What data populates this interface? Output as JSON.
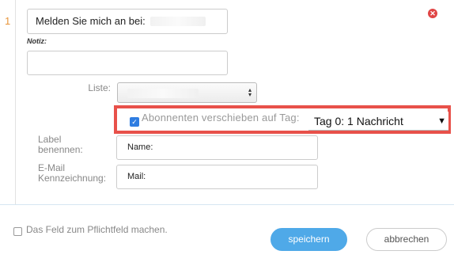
{
  "step": {
    "number": "1"
  },
  "close": {
    "icon": "close-icon",
    "glyph": "✕",
    "color": "#e04545"
  },
  "subject": {
    "value": "Melden Sie mich an bei:"
  },
  "notiz": {
    "label": "Notiz:",
    "value": ""
  },
  "liste": {
    "label": "Liste:",
    "selected": ""
  },
  "move_tag": {
    "checked": true,
    "check_glyph": "✓",
    "label": "Abonnenten verschieben auf Tag:",
    "selected": "Tag 0: 1 Nachricht",
    "arrow": "▼"
  },
  "fields": {
    "name_label": "Label benennen:",
    "name_value": "Name:",
    "mail_label": "E-Mail Kennzeichnung:",
    "mail_value": "Mail:"
  },
  "footer": {
    "required_label": "Das Feld zum Pflichtfeld machen.",
    "required_checked": false,
    "save_label": "speichern",
    "cancel_label": "abbrechen"
  },
  "colors": {
    "accent": "#4fa9e8",
    "highlight": "#e8514a",
    "step_number": "#e8953a",
    "checkbox": "#2f7de1"
  }
}
